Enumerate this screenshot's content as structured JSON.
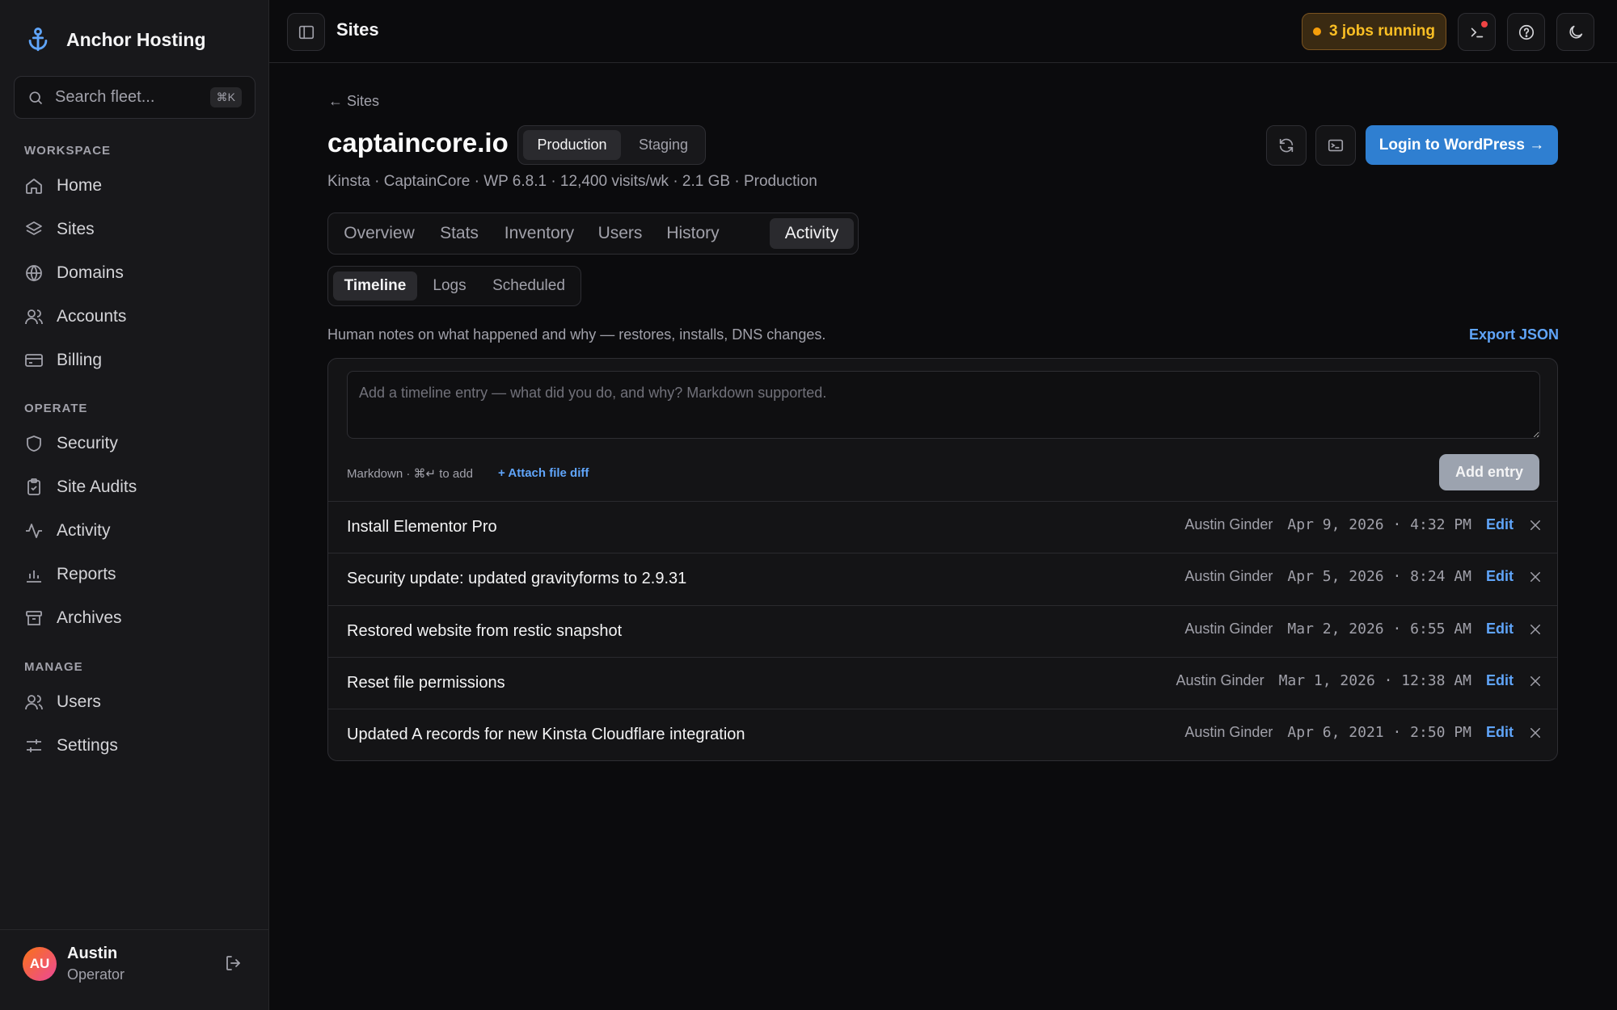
{
  "app": {
    "name": "Anchor Hosting"
  },
  "search": {
    "placeholder": "Search fleet...",
    "shortcut": "⌘K"
  },
  "sidebar": {
    "sections": [
      {
        "label": "WORKSPACE",
        "items": [
          {
            "label": "Home",
            "icon": "home-icon"
          },
          {
            "label": "Sites",
            "icon": "layers-icon"
          },
          {
            "label": "Domains",
            "icon": "globe-icon"
          },
          {
            "label": "Accounts",
            "icon": "users-icon"
          },
          {
            "label": "Billing",
            "icon": "card-icon"
          }
        ]
      },
      {
        "label": "OPERATE",
        "items": [
          {
            "label": "Security",
            "icon": "shield-icon"
          },
          {
            "label": "Site Audits",
            "icon": "clipboard-icon"
          },
          {
            "label": "Activity",
            "icon": "activity-icon"
          },
          {
            "label": "Reports",
            "icon": "bar-chart-icon"
          },
          {
            "label": "Archives",
            "icon": "archive-icon"
          }
        ]
      },
      {
        "label": "MANAGE",
        "items": [
          {
            "label": "Users",
            "icon": "users-icon"
          },
          {
            "label": "Settings",
            "icon": "sliders-icon"
          }
        ]
      }
    ]
  },
  "user": {
    "initials": "AU",
    "name": "Austin",
    "role": "Operator"
  },
  "topbar": {
    "title": "Sites",
    "jobs_label": "3 jobs running"
  },
  "site": {
    "back_label": "← Sites",
    "name": "captaincore.io",
    "environments": [
      "Production",
      "Staging"
    ],
    "active_environment": "Production",
    "meta": "Kinsta · CaptainCore · WP 6.8.1 · 12,400 visits/wk · 2.1 GB · Production",
    "login_label": "Login to WordPress →"
  },
  "tabs": [
    "Overview",
    "Stats",
    "Inventory",
    "Users",
    "History",
    "Activity"
  ],
  "active_tab": "Activity",
  "subtabs": [
    "Timeline",
    "Logs",
    "Scheduled"
  ],
  "active_subtab": "Timeline",
  "timeline": {
    "description": "Human notes on what happened and why — restores, installs, DNS changes.",
    "export_label": "Export JSON",
    "composer_placeholder": "Add a timeline entry — what did you do, and why? Markdown supported.",
    "hint": "Markdown · ⌘↵ to add",
    "attach_label": "+ Attach file diff",
    "add_label": "Add entry",
    "edit_label": "Edit",
    "entries": [
      {
        "title": "Install Elementor Pro",
        "author": "Austin Ginder",
        "date": "Apr 9, 2026 · 4:32 PM"
      },
      {
        "title": "Security update: updated gravityforms to 2.9.31",
        "author": "Austin Ginder",
        "date": "Apr 5, 2026 · 8:24 AM"
      },
      {
        "title": "Restored website from restic snapshot",
        "author": "Austin Ginder",
        "date": "Mar 2, 2026 · 6:55 AM"
      },
      {
        "title": "Reset file permissions",
        "author": "Austin Ginder",
        "date": "Mar 1, 2026 · 12:38 AM"
      },
      {
        "title": "Updated A records for new Kinsta Cloudflare integration",
        "author": "Austin Ginder",
        "date": "Apr 6, 2021 · 2:50 PM"
      }
    ]
  },
  "colors": {
    "accent": "#2f7fd1",
    "link": "#60a5fa",
    "warning": "#fbbf24",
    "background": "#0b0b0d",
    "sidebar": "#18181b"
  }
}
